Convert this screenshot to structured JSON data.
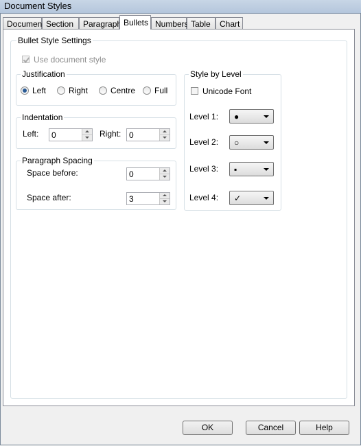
{
  "window": {
    "title": "Document Styles"
  },
  "tabs": [
    {
      "label": "Document"
    },
    {
      "label": "Section"
    },
    {
      "label": "Paragraph"
    },
    {
      "label": "Bullets"
    },
    {
      "label": "Numbers"
    },
    {
      "label": "Table"
    },
    {
      "label": "Chart"
    }
  ],
  "active_tab": "Bullets",
  "bullet_settings": {
    "label": "Bullet Style Settings",
    "use_document_style": {
      "label": "Use document style",
      "checked": true,
      "disabled": true
    }
  },
  "justification": {
    "label": "Justification",
    "options": [
      {
        "label": "Left",
        "checked": true
      },
      {
        "label": "Right",
        "checked": false
      },
      {
        "label": "Centre",
        "checked": false
      },
      {
        "label": "Full",
        "checked": false
      }
    ]
  },
  "indentation": {
    "label": "Indentation",
    "left": {
      "label": "Left:",
      "value": "0"
    },
    "right": {
      "label": "Right:",
      "value": "0"
    }
  },
  "paragraph_spacing": {
    "label": "Paragraph Spacing",
    "before": {
      "label": "Space before:",
      "value": "0"
    },
    "after": {
      "label": "Space after:",
      "value": "3"
    }
  },
  "style_by_level": {
    "label": "Style by Level",
    "unicode_font": {
      "label": "Unicode Font",
      "checked": false
    },
    "levels": [
      {
        "label": "Level 1:",
        "symbol": "●"
      },
      {
        "label": "Level 2:",
        "symbol": "○"
      },
      {
        "label": "Level 3:",
        "symbol": "▪"
      },
      {
        "label": "Level 4:",
        "symbol": "✓"
      }
    ]
  },
  "buttons": {
    "ok": "OK",
    "cancel": "Cancel",
    "help": "Help"
  }
}
